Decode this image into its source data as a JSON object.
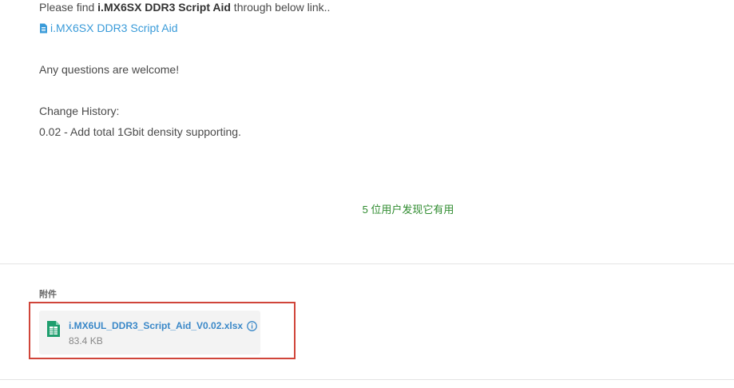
{
  "post": {
    "intro_prefix": "Please find ",
    "intro_bold": "i.MX6SX DDR3 Script Aid",
    "intro_suffix": " through below link..",
    "doc_link_label": "i.MX6SX DDR3 Script Aid",
    "questions": "Any questions are welcome!",
    "history_title": "Change History:",
    "history_items": [
      "0.02 - Add total 1Gbit density supporting."
    ]
  },
  "feedback": {
    "helpful_text": "5 位用户发现它有用"
  },
  "attachments": {
    "title": "附件",
    "files": [
      {
        "name": "i.MX6UL_DDR3_Script_Aid_V0.02.xlsx",
        "size": "83.4 KB",
        "icon": "spreadsheet-icon"
      }
    ]
  },
  "colors": {
    "link": "#3a9bd9",
    "helpful": "#2e8b2e",
    "highlight": "#d0453a",
    "spreadsheet_icon": "#1f9e6e"
  }
}
